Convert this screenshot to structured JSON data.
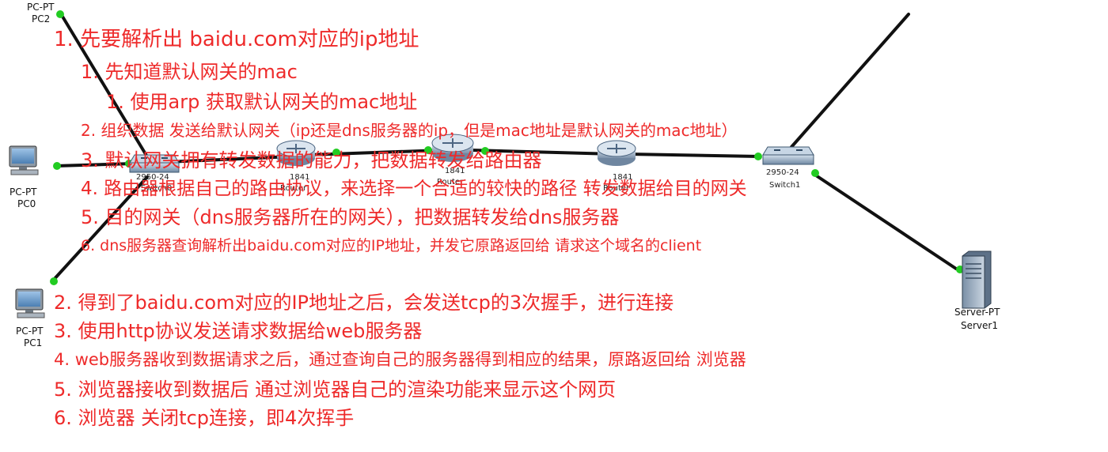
{
  "colors": {
    "annotation": "#ee2a2a",
    "link": "#111111",
    "port_up": "#22cc22"
  },
  "devices": {
    "pc2": {
      "type": "PC-PT",
      "name": "PC2",
      "icon": "pc-icon"
    },
    "pc0": {
      "type": "PC-PT",
      "name": "PC0",
      "icon": "pc-icon"
    },
    "pc1": {
      "type": "PC-PT",
      "name": "PC1",
      "icon": "pc-icon"
    },
    "switch0": {
      "model": "2950-24",
      "name": "Switch0",
      "icon": "switch-icon"
    },
    "router_left": {
      "model": "1841",
      "name": "Router",
      "icon": "router-icon"
    },
    "router_mid": {
      "model": "1841",
      "name": "Router",
      "icon": "router-icon"
    },
    "router_right": {
      "model": "1841",
      "name": "Router",
      "icon": "router-icon"
    },
    "switch1": {
      "model": "2950-24",
      "name": "Switch1",
      "icon": "switch-icon"
    },
    "server1": {
      "type": "Server-PT",
      "name": "Server1",
      "icon": "server-icon"
    }
  },
  "notes": [
    "1. 先要解析出 baidu.com对应的ip地址",
    "1. 先知道默认网关的mac",
    "1. 使用arp 获取默认网关的mac地址",
    "2. 组织数据 发送给默认网关（ip还是dns服务器的ip，但是mac地址是默认网关的mac地址）",
    "3. 默认网关拥有转发数据的能力，把数据转发给路由器",
    "4. 路由器根据自己的路由协议，来选择一个合适的较快的路径 转发数据给目的网关",
    "5. 目的网关（dns服务器所在的网关），把数据转发给dns服务器",
    "6. dns服务器查询解析出baidu.com对应的IP地址，并发它原路返回给 请求这个域名的client",
    "2. 得到了baidu.com对应的IP地址之后，会发送tcp的3次握手，进行连接",
    "3. 使用http协议发送请求数据给web服务器",
    "4. web服务器收到数据请求之后，通过查询自己的服务器得到相应的结果，原路返回给 浏览器",
    "5. 浏览器接收到数据后 通过浏览器自己的渲染功能来显示这个网页",
    "6. 浏览器 关闭tcp连接，即4次挥手"
  ]
}
